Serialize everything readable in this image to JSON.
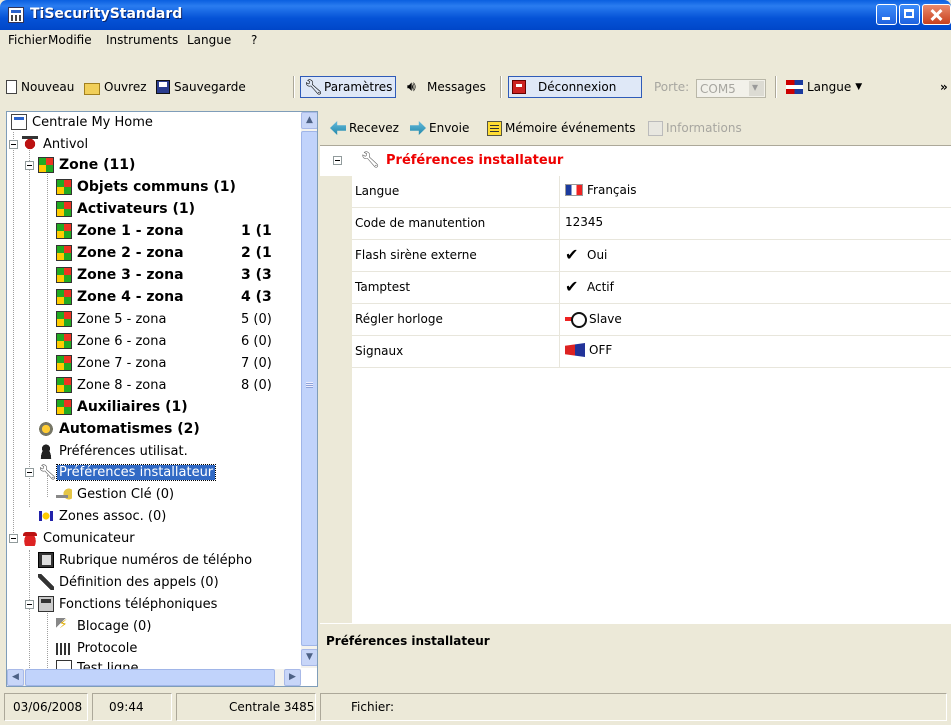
{
  "window": {
    "title": "TiSecurityStandard"
  },
  "menu": [
    "Fichier",
    "Modifie",
    "Instruments",
    "Langue",
    "?"
  ],
  "toolbar": {
    "new_label": "Nouveau",
    "open_label": "Ouvrez",
    "save_label": "Sauvegarde",
    "params_label": "Paramètres",
    "messages_label": "Messages",
    "disconnect_label": "Déconnexion",
    "port_label": "Porte:",
    "port_value": "COM5",
    "language_label": "Langue",
    "overflow": "»"
  },
  "tree": {
    "items": [
      {
        "label": "Centrale My Home",
        "icon": "control-panel-icon"
      },
      {
        "label": "Antivol",
        "icon": "alarm-icon"
      },
      {
        "label": "Zone (11)",
        "icon": "zone-icon"
      },
      {
        "label": "Objets communs (1)",
        "icon": "zone-icon"
      },
      {
        "label": "Activateurs (1)",
        "icon": "zone-icon"
      },
      {
        "label": "Zone 1 - zona",
        "count": "1 (1",
        "icon": "zone-icon"
      },
      {
        "label": "Zone 2 - zona",
        "count": "2 (1",
        "icon": "zone-icon"
      },
      {
        "label": "Zone 3 - zona",
        "count": "3 (3",
        "icon": "zone-icon"
      },
      {
        "label": "Zone 4 - zona",
        "count": "4 (3",
        "icon": "zone-icon"
      },
      {
        "label": "Zone 5 - zona",
        "count": "5 (0)",
        "icon": "zone-icon"
      },
      {
        "label": "Zone 6 - zona",
        "count": "6 (0)",
        "icon": "zone-icon"
      },
      {
        "label": "Zone 7 - zona",
        "count": "7 (0)",
        "icon": "zone-icon"
      },
      {
        "label": "Zone 8 - zona",
        "count": "8 (0)",
        "icon": "zone-icon"
      },
      {
        "label": "Auxiliaires (1)",
        "icon": "zone-icon"
      },
      {
        "label": "Automatismes (2)",
        "icon": "gear-icon"
      },
      {
        "label": "Préférences utilisat.",
        "icon": "user-icon"
      },
      {
        "label": "Préférences installateur",
        "icon": "wrench-icon"
      },
      {
        "label": "Gestion Clé (0)",
        "icon": "key-icon"
      },
      {
        "label": "Zones assoc. (0)",
        "icon": "zones-assoc-icon"
      },
      {
        "label": "Comunicateur",
        "icon": "phone-icon"
      },
      {
        "label": "Rubrique numéros de télépho",
        "icon": "phonebook-icon"
      },
      {
        "label": "Définition des appels (0)",
        "icon": "handset-icon"
      },
      {
        "label": "Fonctions téléphoniques",
        "icon": "fax-icon"
      },
      {
        "label": "Blocage (0)",
        "icon": "filter-icon"
      },
      {
        "label": "Protocole",
        "icon": "protocol-icon"
      },
      {
        "label": "Test ligne",
        "icon": "test-icon"
      }
    ]
  },
  "right_toolbar": {
    "receive_label": "Recevez",
    "send_label": "Envoie",
    "memory_label": "Mémoire événements",
    "info_label": "Informations"
  },
  "properties": {
    "section_title": "Préférences installateur",
    "rows": [
      {
        "key": "Langue",
        "value": "Français",
        "icon": "france-flag-icon"
      },
      {
        "key": "Code de manutention",
        "value": "12345",
        "icon": ""
      },
      {
        "key": "Flash sirène externe",
        "value": "Oui",
        "icon": "checkmark-icon"
      },
      {
        "key": "Tamptest",
        "value": "Actif",
        "icon": "checkmark-icon"
      },
      {
        "key": "Régler horloge",
        "value": "Slave",
        "icon": "clock-icon"
      },
      {
        "key": "Signaux",
        "value": "OFF",
        "icon": "signal-off-icon"
      }
    ],
    "description_title": "Préférences installateur"
  },
  "status": {
    "date": "03/06/2008",
    "time": "09:44",
    "centrale": "Centrale 3485",
    "file_label": "Fichier:"
  },
  "colors": {
    "selection": "#316ac5",
    "section_title": "#ee0000",
    "titlebar": "#0553d7"
  }
}
